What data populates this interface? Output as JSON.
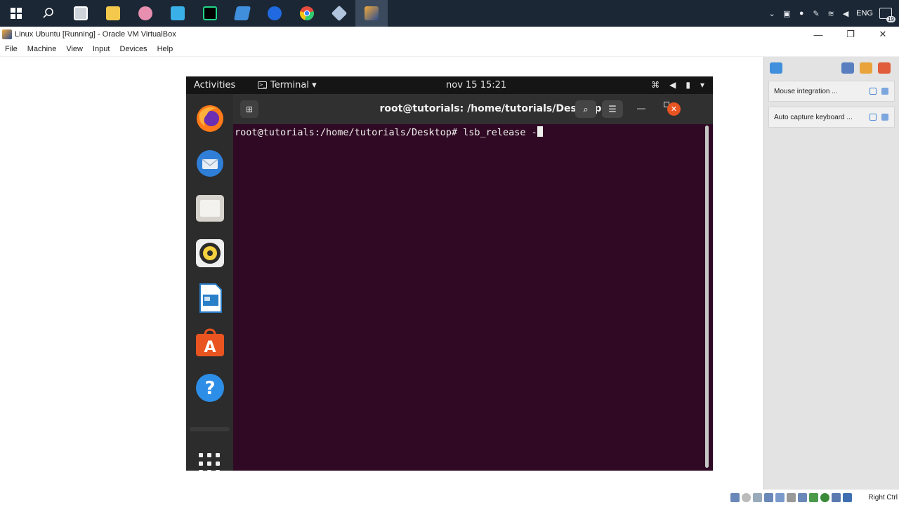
{
  "taskbar": {
    "pinned": [
      {
        "name": "windows-start",
        "color": "#ffffff"
      },
      {
        "name": "search",
        "color": "#ffffff"
      },
      {
        "name": "screenshot-tool",
        "color": "#d8d8d8"
      },
      {
        "name": "file-explorer",
        "color": "#f2c94c"
      },
      {
        "name": "brain-app",
        "color": "#e88fb0"
      },
      {
        "name": "azure-data-studio",
        "color": "#3ab0e8"
      },
      {
        "name": "pycharm",
        "color": "#21d789"
      },
      {
        "name": "powershell",
        "color": "#3f8fdc"
      },
      {
        "name": "webex",
        "color": "#1f6ae0"
      },
      {
        "name": "chrome",
        "color": "#e74c3c"
      },
      {
        "name": "virtualbox-3d",
        "color": "#b0c4de"
      },
      {
        "name": "virtualbox",
        "color": "#f3a93a"
      }
    ],
    "tray": {
      "language": "ENG",
      "notification_count": "19"
    }
  },
  "vbox": {
    "title": "Linux Ubuntu [Running] - Oracle VM VirtualBox",
    "menu": [
      "File",
      "Machine",
      "View",
      "Input",
      "Devices",
      "Help"
    ],
    "host_key": "Right Ctrl"
  },
  "ubuntu": {
    "topbar": {
      "activities": "Activities",
      "app_menu": "Terminal ▾",
      "clock": "nov 15  15:21"
    },
    "dock": [
      {
        "name": "firefox",
        "color": "#ff7a18"
      },
      {
        "name": "thunderbird",
        "color": "#2f7fd8"
      },
      {
        "name": "files",
        "color": "#d6d2cc"
      },
      {
        "name": "rhythmbox",
        "color": "#f4d03f"
      },
      {
        "name": "libreoffice-writer",
        "color": "#2a7fc9"
      },
      {
        "name": "ubuntu-software",
        "color": "#e95420"
      },
      {
        "name": "help",
        "color": "#2d8ee8"
      }
    ],
    "terminal": {
      "title": "root@tutorials: /home/tutorials/Desktop",
      "prompt": "root@tutorials:/home/tutorials/Desktop# ",
      "command": "lsb_release -"
    }
  },
  "vb_panel": {
    "rows": [
      "Mouse integration ...",
      "Auto capture keyboard ..."
    ]
  }
}
